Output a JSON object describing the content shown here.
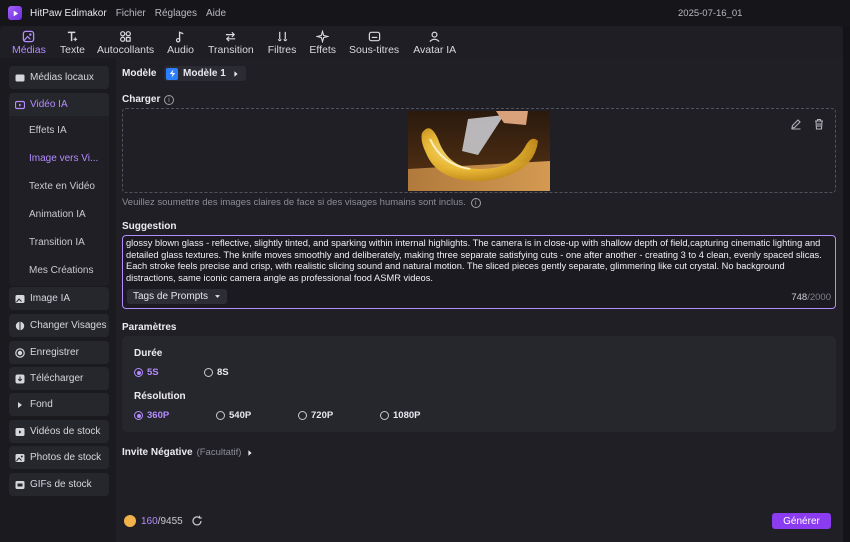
{
  "app": {
    "name": "HitPaw Edimakor",
    "menu": [
      "Fichier",
      "Réglages",
      "Aide"
    ],
    "project_title": "2025-07-16_01"
  },
  "toolbar": {
    "tabs": [
      {
        "label": "Médias",
        "icon": "media-icon",
        "active": true
      },
      {
        "label": "Texte",
        "icon": "text-icon"
      },
      {
        "label": "Autocollants",
        "icon": "sticker-icon"
      },
      {
        "label": "Audio",
        "icon": "audio-icon"
      },
      {
        "label": "Transition",
        "icon": "transition-icon"
      },
      {
        "label": "Filtres",
        "icon": "filter-icon"
      },
      {
        "label": "Effets",
        "icon": "effects-icon"
      },
      {
        "label": "Sous-titres",
        "icon": "subtitles-icon"
      },
      {
        "label": "Avatar IA",
        "icon": "avatar-icon"
      }
    ]
  },
  "sidebar": {
    "items": [
      {
        "label": "Médias locaux",
        "icon": "folder-icon"
      },
      {
        "label": "Vidéo IA",
        "icon": "ai-video-icon",
        "active": true
      },
      {
        "label": "Image IA",
        "icon": "ai-image-icon"
      },
      {
        "label": "Changer Visages",
        "icon": "face-swap-icon"
      },
      {
        "label": "Enregistrer",
        "icon": "record-icon"
      },
      {
        "label": "Télécharger",
        "icon": "download-icon"
      },
      {
        "label": "Fond",
        "icon": "caret-right-icon"
      },
      {
        "label": "Vidéos de stock",
        "icon": "stock-video-icon"
      },
      {
        "label": "Photos de stock",
        "icon": "stock-photo-icon"
      },
      {
        "label": "GIFs de stock",
        "icon": "gif-icon"
      }
    ],
    "sub_items": [
      {
        "label": "Effets IA"
      },
      {
        "label": "Image vers Vi...",
        "active": true
      },
      {
        "label": "Texte en Vidéo"
      },
      {
        "label": "Animation IA"
      },
      {
        "label": "Transition IA"
      },
      {
        "label": "Mes Créations"
      }
    ]
  },
  "main": {
    "model_label": "Modèle",
    "model_value": "Modèle 1",
    "upload_label": "Charger",
    "upload_hint": "Veuillez soumettre des images claires de face si des visages humains sont inclus.",
    "suggestion_label": "Suggestion",
    "prompt": "glossy blown glass - reflective, slightly tinted, and sparking within internal highlights. The camera is in close-up with shallow depth of field,capturing cinematic lighting and detailed glass textures. The knife moves smoothly and deliberately, making three separate satisfying cuts - one after another - creating 3 to 4 clean, evenly spaced slicas. Each stroke feels precise and crisp, with realistic slicing sound and natural motion. The sliced pieces gently separate, glimmering like cut crystal. No background distractions, same iconic camera angle as professional food ASMR videos.",
    "tags_button": "Tags de Prompts",
    "char_count": "748",
    "char_max": "/2000",
    "params_label": "Paramètres",
    "duration_label": "Durée",
    "durations": [
      {
        "label": "5S",
        "selected": true
      },
      {
        "label": "8S"
      }
    ],
    "resolution_label": "Résolution",
    "resolutions": [
      {
        "label": "360P",
        "selected": true
      },
      {
        "label": "540P"
      },
      {
        "label": "720P"
      },
      {
        "label": "1080P"
      }
    ],
    "negative_label": "Invite Négative",
    "negative_optional": "(Facultatif)"
  },
  "footer": {
    "credits_used": "160",
    "credits_total": "/9455",
    "generate_button": "Générer"
  },
  "colors": {
    "accent": "#b48cff",
    "button": "#8b3cf0",
    "background": "#1f1f25"
  }
}
